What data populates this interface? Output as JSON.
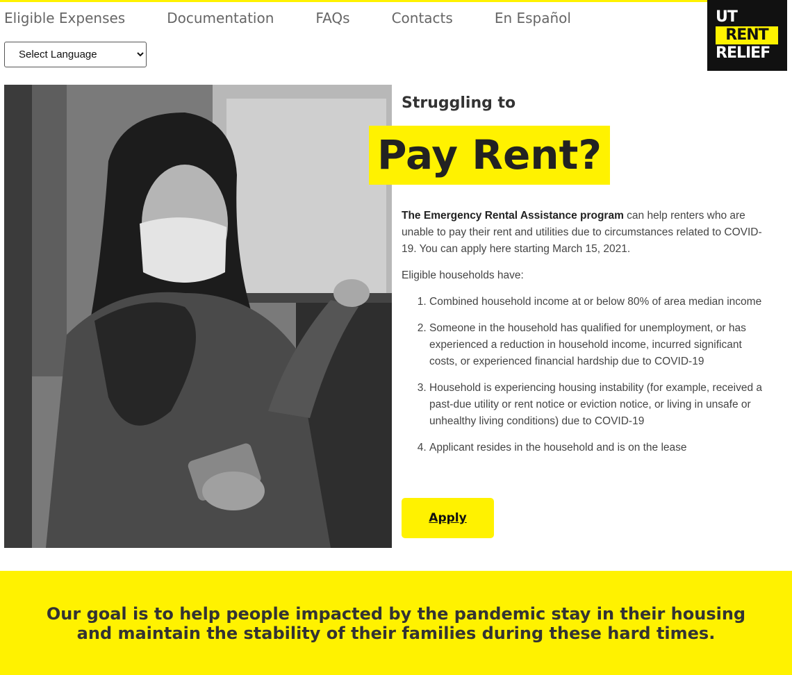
{
  "nav": {
    "items": [
      {
        "label": "Eligible Expenses"
      },
      {
        "label": "Documentation"
      },
      {
        "label": "FAQs"
      },
      {
        "label": "Contacts"
      },
      {
        "label": "En Español"
      }
    ]
  },
  "language_select": {
    "selected": "Select Language"
  },
  "logo": {
    "line1": "UT",
    "line2": "RENT",
    "line3": "RELIEF"
  },
  "hero": {
    "kicker": "Struggling to",
    "headline": "Pay Rent?"
  },
  "intro": {
    "program_name": "The Emergency Rental Assistance program",
    "text": " can help renters who are unable to pay their rent and utilities due to circumstances related to COVID-19. You can apply here starting March 15, 2021."
  },
  "eligible": {
    "heading": "Eligible households have:",
    "items": [
      "Combined household income at or below 80% of area median income",
      "Someone in the household has qualified for unemployment, or has experienced a reduction in household income, incurred significant costs, or experienced financial hardship due to COVID-19",
      "Household is experiencing housing instability (for example, received a past-due utility or rent notice or eviction notice, or living in unsafe or unhealthy living conditions) due to COVID-19",
      "Applicant resides in the household and is on the lease"
    ]
  },
  "apply_button": {
    "label": "Apply"
  },
  "banner": {
    "text": "Our goal is to help people impacted by the pandemic stay in their housing and maintain the stability of their families during these hard times."
  },
  "colors": {
    "accent": "#fff200",
    "text": "#333333",
    "logo_bg": "#111111"
  }
}
